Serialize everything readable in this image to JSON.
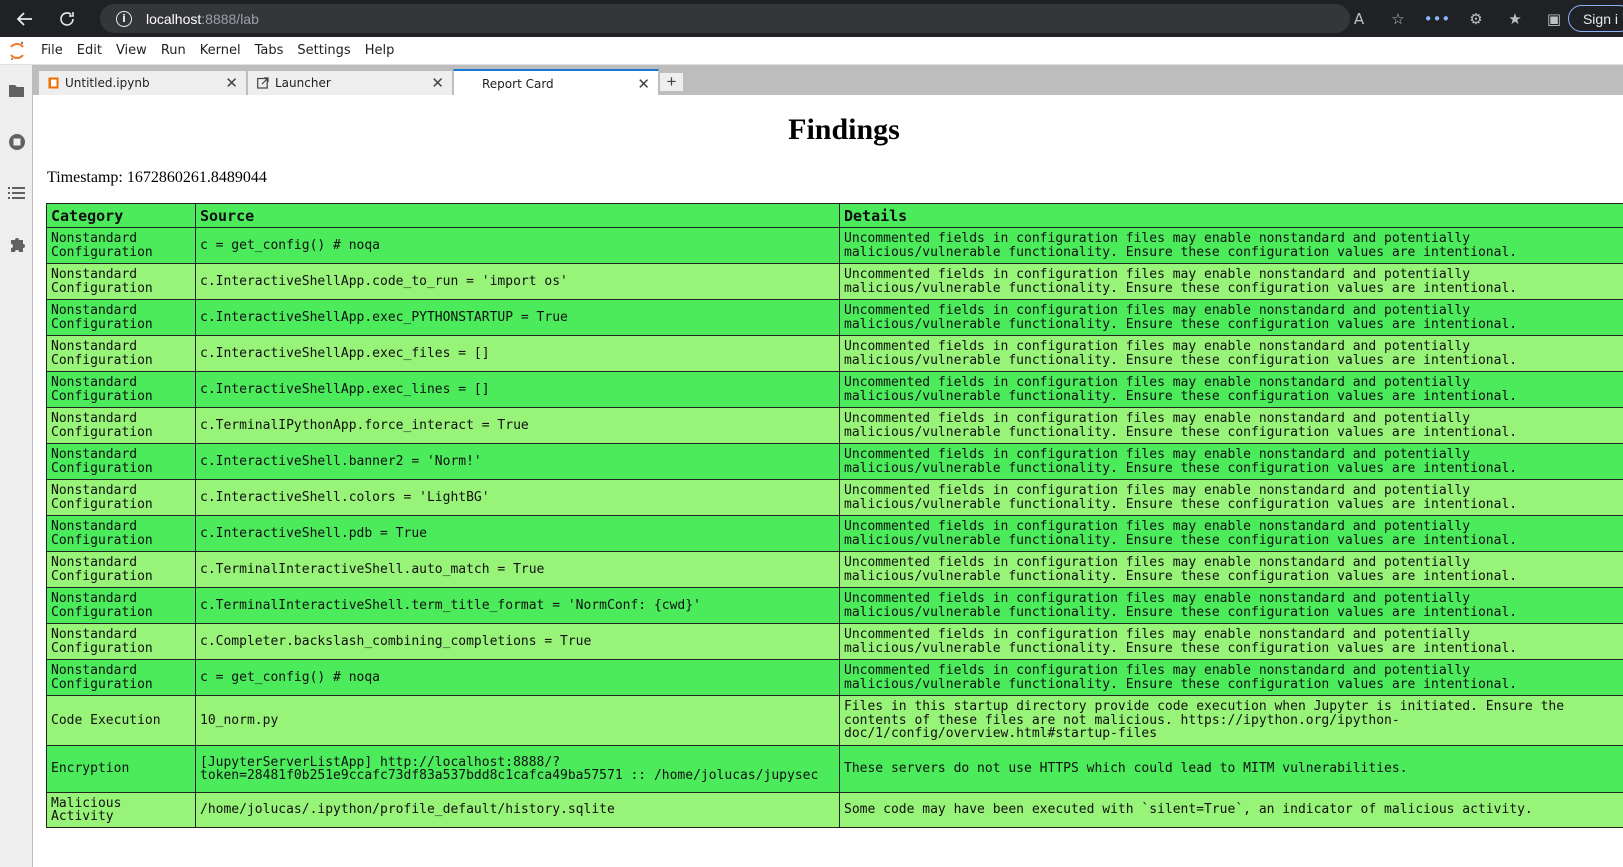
{
  "browser": {
    "url_host": "localhost",
    "url_rest": ":8888/lab",
    "signin_label": "Sign i"
  },
  "menu": [
    "File",
    "Edit",
    "View",
    "Run",
    "Kernel",
    "Tabs",
    "Settings",
    "Help"
  ],
  "tabs": [
    {
      "label": "Untitled.ipynb",
      "icon": "notebook-icon"
    },
    {
      "label": "Launcher",
      "icon": "launcher-icon"
    },
    {
      "label": "Report Card",
      "icon": ""
    }
  ],
  "report": {
    "title": "Findings",
    "timestamp": "Timestamp: 1672860261.8489044",
    "headers": [
      "Category",
      "Source",
      "Details"
    ],
    "rows": [
      {
        "category": "Nonstandard Configuration",
        "source": "c = get_config() # noqa",
        "details": "Uncommented fields in configuration files may enable nonstandard and potentially malicious/vulnerable functionality. Ensure these configuration values are intentional."
      },
      {
        "category": "Nonstandard Configuration",
        "source": "c.InteractiveShellApp.code_to_run = 'import os'",
        "details": "Uncommented fields in configuration files may enable nonstandard and potentially malicious/vulnerable functionality. Ensure these configuration values are intentional."
      },
      {
        "category": "Nonstandard Configuration",
        "source": "c.InteractiveShellApp.exec_PYTHONSTARTUP = True",
        "details": "Uncommented fields in configuration files may enable nonstandard and potentially malicious/vulnerable functionality. Ensure these configuration values are intentional."
      },
      {
        "category": "Nonstandard Configuration",
        "source": "c.InteractiveShellApp.exec_files = []",
        "details": "Uncommented fields in configuration files may enable nonstandard and potentially malicious/vulnerable functionality. Ensure these configuration values are intentional."
      },
      {
        "category": "Nonstandard Configuration",
        "source": "c.InteractiveShellApp.exec_lines = []",
        "details": "Uncommented fields in configuration files may enable nonstandard and potentially malicious/vulnerable functionality. Ensure these configuration values are intentional."
      },
      {
        "category": "Nonstandard Configuration",
        "source": "c.TerminalIPythonApp.force_interact = True",
        "details": "Uncommented fields in configuration files may enable nonstandard and potentially malicious/vulnerable functionality. Ensure these configuration values are intentional."
      },
      {
        "category": "Nonstandard Configuration",
        "source": "c.InteractiveShell.banner2 = 'Norm!'",
        "details": "Uncommented fields in configuration files may enable nonstandard and potentially malicious/vulnerable functionality. Ensure these configuration values are intentional."
      },
      {
        "category": "Nonstandard Configuration",
        "source": "c.InteractiveShell.colors = 'LightBG'",
        "details": "Uncommented fields in configuration files may enable nonstandard and potentially malicious/vulnerable functionality. Ensure these configuration values are intentional."
      },
      {
        "category": "Nonstandard Configuration",
        "source": "c.InteractiveShell.pdb = True",
        "details": "Uncommented fields in configuration files may enable nonstandard and potentially malicious/vulnerable functionality. Ensure these configuration values are intentional."
      },
      {
        "category": "Nonstandard Configuration",
        "source": "c.TerminalInteractiveShell.auto_match = True",
        "details": "Uncommented fields in configuration files may enable nonstandard and potentially malicious/vulnerable functionality. Ensure these configuration values are intentional."
      },
      {
        "category": "Nonstandard Configuration",
        "source": "c.TerminalInteractiveShell.term_title_format = 'NormConf: {cwd}'",
        "details": "Uncommented fields in configuration files may enable nonstandard and potentially malicious/vulnerable functionality. Ensure these configuration values are intentional."
      },
      {
        "category": "Nonstandard Configuration",
        "source": "c.Completer.backslash_combining_completions = True",
        "details": "Uncommented fields in configuration files may enable nonstandard and potentially malicious/vulnerable functionality. Ensure these configuration values are intentional."
      },
      {
        "category": "Nonstandard Configuration",
        "source": "c = get_config() # noqa",
        "details": "Uncommented fields in configuration files may enable nonstandard and potentially malicious/vulnerable functionality. Ensure these configuration values are intentional."
      },
      {
        "category": "Code Execution",
        "source": "10_norm.py",
        "details": "Files in this startup directory provide code execution when Jupyter is initiated. Ensure the contents of these files are not malicious. https://ipython.org/ipython-doc/1/config/overview.html#startup-files"
      },
      {
        "category": "Encryption",
        "source": "[JupyterServerListApp] http://localhost:8888/?token=28481f0b251e9ccafc73df83a537bdd8c1cafca49ba57571 :: /home/jolucas/jupysec",
        "details": "These servers do not use HTTPS which could lead to MITM vulnerabilities."
      },
      {
        "category": "Malicious Activity",
        "source": "/home/jolucas/.ipython/profile_default/history.sqlite",
        "details": "Some code may have been executed with `silent=True`, an indicator of malicious activity."
      }
    ]
  }
}
